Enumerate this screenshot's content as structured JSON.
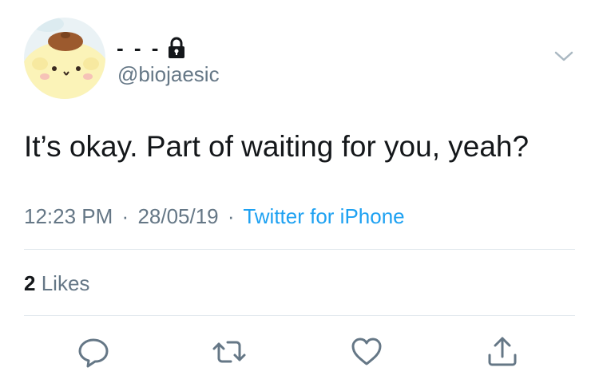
{
  "user": {
    "display_name": "- - -",
    "handle": "@biojaesic"
  },
  "tweet": {
    "text": "It’s okay. Part of waiting for you, yeah?",
    "time": "12:23 PM",
    "date": "28/05/19",
    "separator": "·",
    "source": "Twitter for iPhone",
    "likes_count": "2",
    "likes_label": "Likes"
  },
  "icons": {
    "avatar": "pompompurin-avatar",
    "protected": "lock-icon",
    "menu": "chevron-down-icon",
    "actions": [
      "reply-icon",
      "retweet-icon",
      "like-icon",
      "share-icon"
    ]
  },
  "colors": {
    "text": "#14171a",
    "secondary": "#657786",
    "link": "#1da1f2",
    "divider": "#e1e8ed",
    "avatar_background": "#eaf2f5",
    "avatar_face": "#fbf3b8"
  }
}
